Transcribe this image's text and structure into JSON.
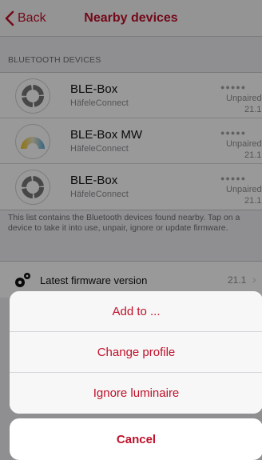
{
  "navbar": {
    "back_label": "Back",
    "title": "Nearby devices"
  },
  "section_header": "BLUETOOTH DEVICES",
  "devices": [
    {
      "name": "BLE-Box",
      "subtitle": "HäfeleConnect",
      "dots": "●●●●●",
      "status": "Unpaired",
      "version": "21.1",
      "icon": "ring-grey-icon"
    },
    {
      "name": "BLE-Box MW",
      "subtitle": "HäfeleConnect",
      "dots": "●●●●●",
      "status": "Unpaired",
      "version": "21.1",
      "icon": "multiwhite-arc-icon"
    },
    {
      "name": "BLE-Box",
      "subtitle": "HäfeleConnect",
      "dots": "●●●●●",
      "status": "Unpaired",
      "version": "21.1",
      "icon": "ring-grey-icon"
    }
  ],
  "footer_note": "This list contains the Bluetooth devices found nearby. Tap on a device to take it into use, unpair, ignore or update firmware.",
  "firmware_row": {
    "label": "Latest firmware version",
    "value": "21.1",
    "icon": "gears-icon"
  },
  "action_sheet": {
    "items": [
      {
        "label": "Add to ..."
      },
      {
        "label": "Change profile"
      },
      {
        "label": "Ignore luminaire"
      }
    ],
    "cancel_label": "Cancel"
  },
  "colors": {
    "accent": "#c0102a",
    "background": "#efeff4",
    "secondary_text": "#8e8e93"
  }
}
